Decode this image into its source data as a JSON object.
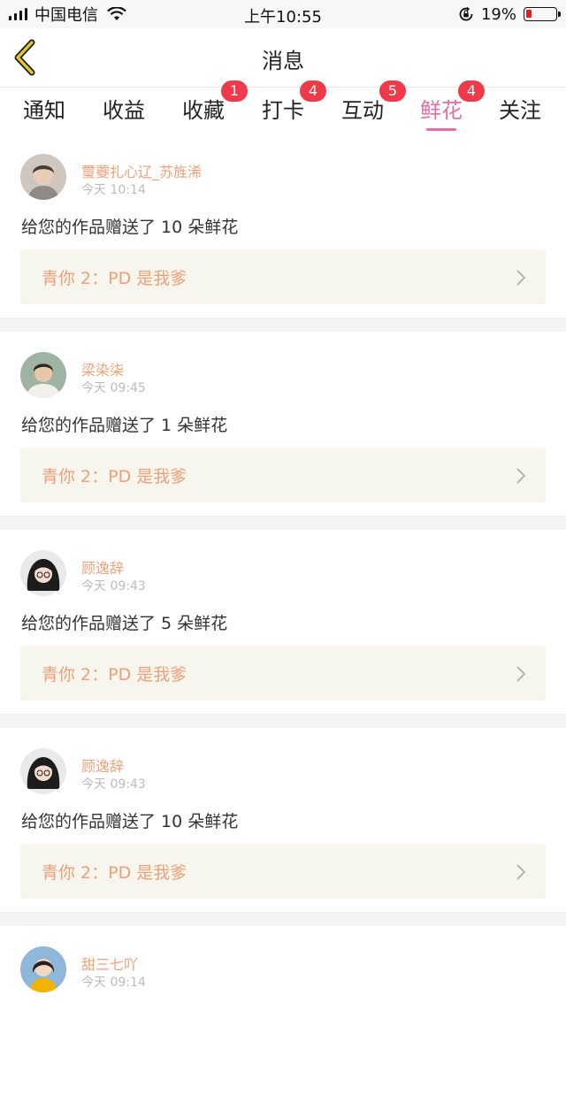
{
  "status_bar": {
    "carrier": "中国电信",
    "time": "上午10:55",
    "battery_percent": "19%",
    "battery_level": 0.19,
    "icons": [
      "signal-icon",
      "wifi-icon",
      "rotation-lock-icon",
      "battery-icon"
    ]
  },
  "header": {
    "title": "消息",
    "back_icon": "chevron-left-icon",
    "back_color": "#e6c62e"
  },
  "tabs": [
    {
      "label": "通知",
      "badge": ""
    },
    {
      "label": "收益",
      "badge": ""
    },
    {
      "label": "收藏",
      "badge": "1"
    },
    {
      "label": "打卡",
      "badge": "4"
    },
    {
      "label": "互动",
      "badge": "5"
    },
    {
      "label": "鲜花",
      "badge": "4",
      "active": true
    },
    {
      "label": "关注",
      "badge": ""
    }
  ],
  "colors": {
    "accent_pink": "#ea6aa2",
    "badge_red": "#ee3a49",
    "name_orange": "#f0a076",
    "work_bg": "#f6f5ee"
  },
  "feed": [
    {
      "name": "璽虁扎心辽_苏旌浠",
      "time": "今天 10:14",
      "message": "给您的作品赠送了 10 朵鲜花",
      "work_title": "青你 2：PD 是我爹"
    },
    {
      "name": "梁染柒",
      "time": "今天 09:45",
      "message": "给您的作品赠送了 1 朵鲜花",
      "work_title": "青你 2：PD 是我爹"
    },
    {
      "name": "顾逸辞",
      "time": "今天 09:43",
      "message": "给您的作品赠送了 5 朵鲜花",
      "work_title": "青你 2：PD 是我爹"
    },
    {
      "name": "顾逸辞",
      "time": "今天 09:43",
      "message": "给您的作品赠送了 10 朵鲜花",
      "work_title": "青你 2：PD 是我爹"
    },
    {
      "name": "甜三七吖",
      "time": "今天 09:14",
      "message": "",
      "work_title": ""
    }
  ]
}
